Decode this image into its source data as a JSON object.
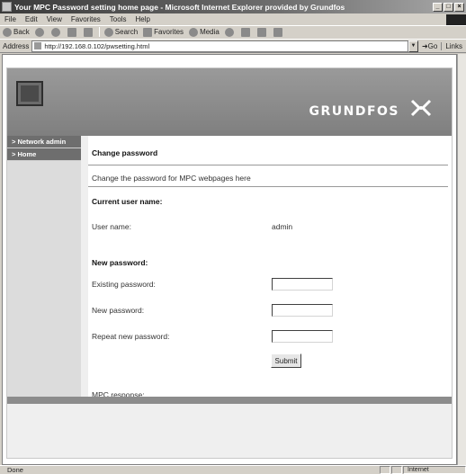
{
  "window": {
    "title": "Your MPC Password setting home page - Microsoft Internet Explorer provided by Grundfos",
    "min_glyph": "_",
    "close_glyph": "×"
  },
  "menu": [
    "File",
    "Edit",
    "View",
    "Favorites",
    "Tools",
    "Help"
  ],
  "toolbar": {
    "back": "Back",
    "search": "Search",
    "favorites": "Favorites",
    "media": "Media"
  },
  "address": {
    "label": "Address",
    "url": "http://192.168.0.102/pwsetting.html",
    "go": "Go",
    "links": "Links"
  },
  "banner": {
    "logo_text": "GRUNDFOS"
  },
  "sidebar": {
    "items": [
      {
        "label": "> Network admin"
      },
      {
        "label": "> Home"
      }
    ]
  },
  "content": {
    "section_title": "Change password",
    "description": "Change the password for MPC webpages here",
    "current_user_heading": "Current user name:",
    "username_label": "User name:",
    "username_value": "admin",
    "new_password_heading": "New password:",
    "existing_label": "Existing password:",
    "new_label": "New password:",
    "repeat_label": "Repeat new password:",
    "submit_label": "Submit",
    "response_label": "MPC response:"
  },
  "status": {
    "text": "Done",
    "zone": "Internet"
  },
  "colors": {
    "banner": "#8a8a8a",
    "nav_item": "#6e6e6e",
    "footer_bar": "#8c8c8c"
  }
}
